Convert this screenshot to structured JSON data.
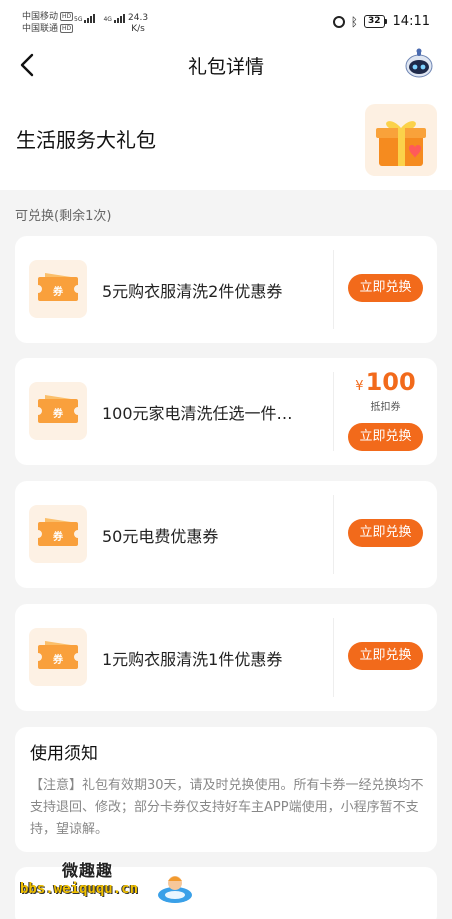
{
  "status_bar": {
    "carrier1": "中国移动",
    "carrier2": "中国联通",
    "net_badge": "HD",
    "sig1": "5G",
    "sig2": "4G",
    "speed_value": "24.3",
    "speed_unit": "K/s",
    "battery": "32",
    "time": "14:11"
  },
  "nav": {
    "title": "礼包详情"
  },
  "package": {
    "title": "生活服务大礼包"
  },
  "section_label": "可兑换(剩余1次)",
  "coupons": [
    {
      "icon_label": "券",
      "name": "5元购衣服清洗2件优惠券",
      "button": "立即兑换"
    },
    {
      "icon_label": "券",
      "name": "100元家电清洗任选一件…",
      "price_symbol": "¥",
      "price": "100",
      "price_note": "抵扣券",
      "button": "立即兑换"
    },
    {
      "icon_label": "券",
      "name": "50元电费优惠券",
      "button": "立即兑换"
    },
    {
      "icon_label": "券",
      "name": "1元购衣服清洗1件优惠券",
      "button": "立即兑换"
    }
  ],
  "notice": {
    "title": "使用须知",
    "text": "【注意】礼包有效期30天，请及时兑换使用。所有卡券一经兑换均不支持退回、修改；部分卡券仅支持好车主APP端使用，小程序暂不支持，望谅解。"
  },
  "watermark": {
    "title": "微趣趣",
    "url": "bbs.weiququ.cn"
  },
  "colors": {
    "accent": "#f26a1b",
    "coupon_bg": "#fdf1e4",
    "page_bg": "#f4f4f4"
  }
}
